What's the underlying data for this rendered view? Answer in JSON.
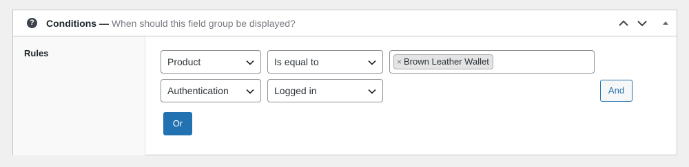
{
  "panel": {
    "title": "Conditions —",
    "subtitle": "When should this field group be displayed?",
    "help_icon": "help-icon",
    "controls": [
      "chevron-up-icon",
      "chevron-down-icon",
      "triangle-up-icon"
    ]
  },
  "rules": {
    "label": "Rules",
    "groups": [
      {
        "rows": [
          {
            "param": "Product",
            "operator": "Is equal to",
            "values": [
              "Brown Leather Wallet"
            ]
          },
          {
            "param": "Authentication",
            "operator": "Logged in"
          }
        ]
      }
    ],
    "and_label": "And",
    "or_label": "Or"
  },
  "colors": {
    "accent": "#2271b1",
    "background": "#f0f0f1",
    "border": "#c3c4c7"
  }
}
